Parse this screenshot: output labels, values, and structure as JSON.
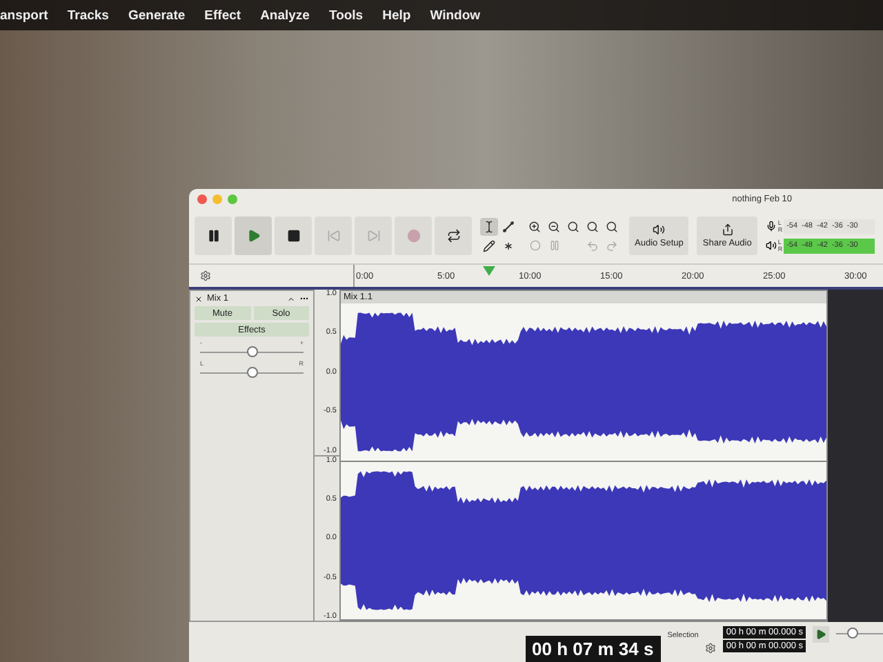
{
  "menu_bar": {
    "items": [
      "ansport",
      "Tracks",
      "Generate",
      "Effect",
      "Analyze",
      "Tools",
      "Help",
      "Window"
    ]
  },
  "window": {
    "title": "nothing Feb 10"
  },
  "transport": [
    {
      "kind": "pause",
      "selected": false,
      "disabled": false
    },
    {
      "kind": "play",
      "selected": true,
      "disabled": false
    },
    {
      "kind": "stop",
      "selected": false,
      "disabled": false
    },
    {
      "kind": "skip_start",
      "selected": false,
      "disabled": true
    },
    {
      "kind": "skip_end",
      "selected": false,
      "disabled": true
    },
    {
      "kind": "record",
      "selected": false,
      "disabled": true
    },
    {
      "kind": "loop",
      "selected": false,
      "disabled": false
    }
  ],
  "tools": [
    {
      "kind": "select",
      "selected": true
    },
    {
      "kind": "envelope",
      "selected": false
    },
    {
      "kind": "draw",
      "selected": false
    },
    {
      "kind": "multi",
      "selected": false
    }
  ],
  "audio_setup": {
    "label": "Audio Setup"
  },
  "share_audio": {
    "label": "Share Audio"
  },
  "meters": [
    {
      "kind": "record",
      "channels": [
        "L",
        "R"
      ],
      "ticks": [
        "-54",
        "-48",
        "-42",
        "-36",
        "-30"
      ]
    },
    {
      "kind": "playback",
      "level": 1,
      "channels": [
        "L",
        "R"
      ],
      "ticks": [
        "-54",
        "-48",
        "-42",
        "-36",
        "-30"
      ]
    }
  ],
  "timeline": {
    "ticks": [
      "0:00",
      "5:00",
      "10:00",
      "15:00",
      "20:00",
      "25:00",
      "30:00"
    ]
  },
  "track": {
    "name": "Mix 1",
    "mute": "Mute",
    "solo": "Solo",
    "effects": "Effects",
    "gain": {
      "level": 0.5,
      "min_label": "-",
      "max_label": "+"
    },
    "pan": {
      "level": 0.5,
      "min_label": "L",
      "max_label": "R"
    },
    "clip": {
      "name": "Mix 1.1"
    },
    "channels": [
      {
        "scale": [
          "1.0",
          "0.5",
          "0.0",
          "-0.5",
          "-1.0"
        ]
      },
      {
        "scale": [
          "1.0",
          "0.5",
          "0.0",
          "-0.5",
          "-1.0"
        ]
      }
    ]
  },
  "time_display": "00 h 07 m 34 s",
  "selection": {
    "label": "Selection",
    "start": "00 h 00 m 00.000 s",
    "end": "00 h 00 m 00.000 s"
  },
  "play_at_speed": {
    "level": 0.35
  }
}
